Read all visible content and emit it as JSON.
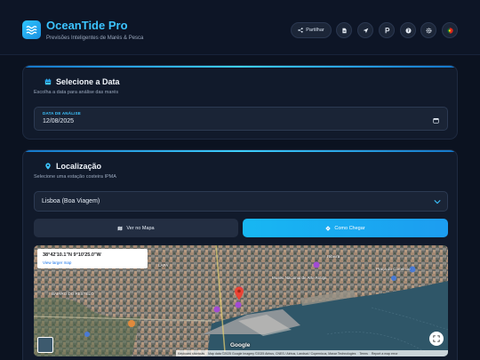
{
  "header": {
    "title": "OceanTide Pro",
    "subtitle": "Previsões Inteligentes de Marés & Pesca",
    "share_label": "Partilhar",
    "icon_buttons": [
      "document-icon",
      "navigation-icon",
      "parking-icon",
      "help-icon",
      "settings-icon",
      "portugal-flag-icon"
    ]
  },
  "date_card": {
    "title": "Selecione a Data",
    "subtitle": "Escolha a data para análise das marés",
    "field_label": "DATA DE ANÁLISE",
    "field_value": "12/08/2025"
  },
  "location_card": {
    "title": "Localização",
    "subtitle": "Selecione uma estação costeira IPMA",
    "selected_station": "Lisboa (Boa Viagem)",
    "map_button": "Ver no Mapa",
    "route_button": "Como Chegar"
  },
  "map": {
    "coordinates": "38°42'10.1\"N 9°10'25.0\"W",
    "larger_map_link": "View larger map",
    "google": "Google",
    "attribution": {
      "shortcuts": "Keyboard shortcuts",
      "map_data": "Map data ©2025 Google Imagery ©2025 Airbus, CNES / Airbus, Landsat / Copernicus, Maxar Technologies",
      "terms": "Terms",
      "report": "Report a map error"
    },
    "labels": {
      "ribeira": "Ribeira",
      "lapa": "LAPA",
      "museu": "Museu Nacional de Arte Antiga",
      "praca": "Praça do Comércio",
      "bairro": "BAIRRO DO RESTELO"
    }
  },
  "colors": {
    "accent": "#3cc4ff",
    "background": "#0b1220",
    "card": "#111a2b",
    "pin": "#ea4335"
  }
}
